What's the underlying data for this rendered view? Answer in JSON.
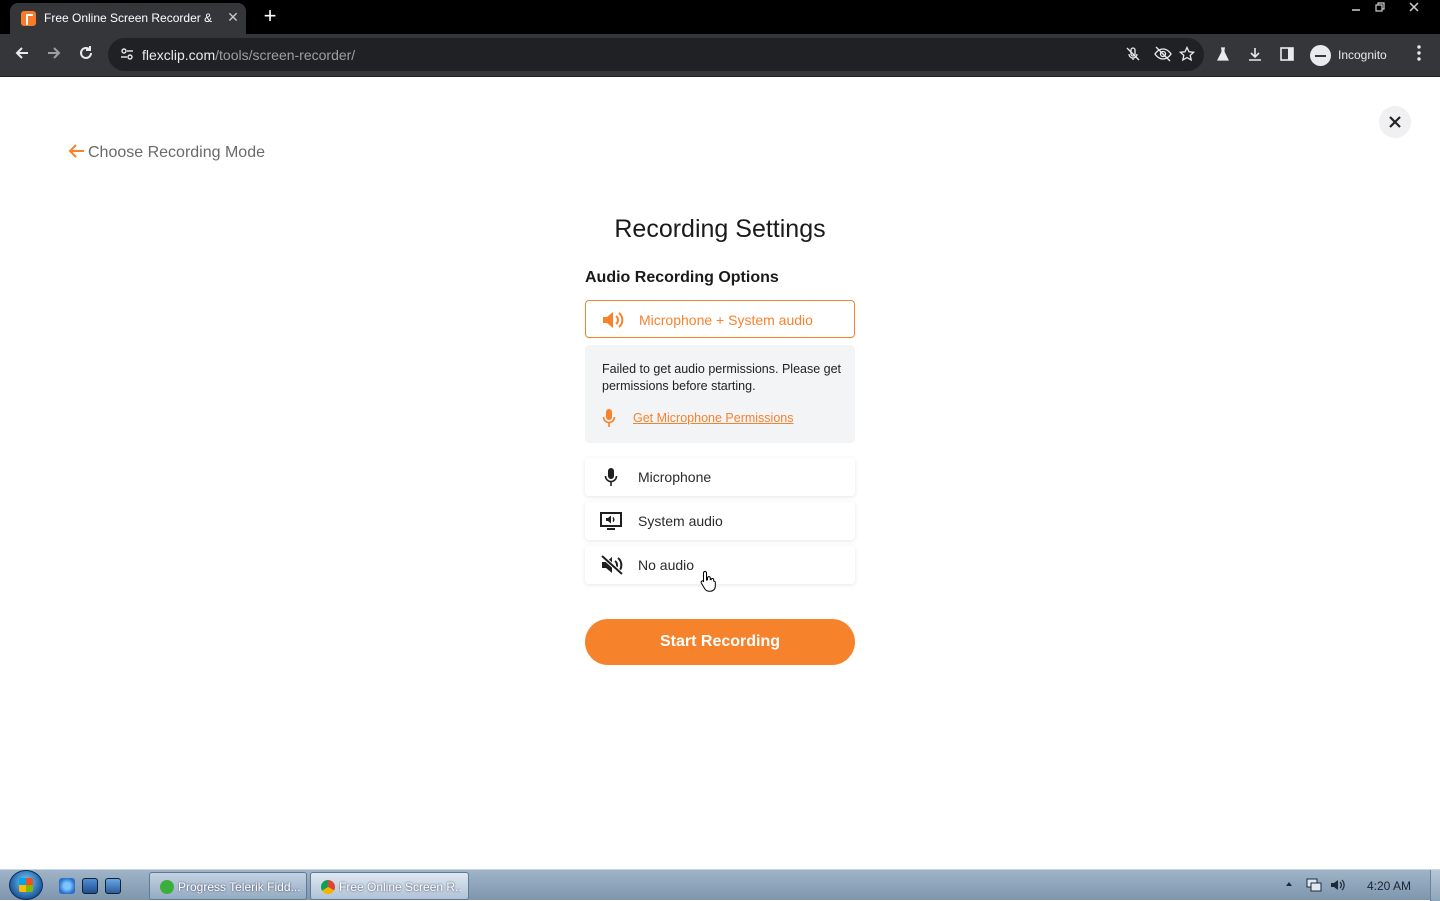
{
  "browser": {
    "tab_title": "Free Online Screen Recorder & Video",
    "tab_close": "✕",
    "new_tab": "+",
    "url_domain": "flexclip.com",
    "url_path": "/tools/screen-recorder/",
    "profile_label": "Incognito"
  },
  "page": {
    "back_label": "Choose Recording Mode",
    "title": "Recording Settings",
    "section_label": "Audio Recording Options",
    "options": [
      {
        "label": "Microphone + System audio",
        "icon": "speaker-icon",
        "selected": true
      },
      {
        "label": "Microphone",
        "icon": "microphone-icon",
        "selected": false
      },
      {
        "label": "System audio",
        "icon": "monitor-audio-icon",
        "selected": false
      },
      {
        "label": "No audio",
        "icon": "mute-icon",
        "selected": false
      }
    ],
    "permission_message": "Failed to get audio permissions. Please get permissions before starting.",
    "permission_link": "Get Microphone Permissions",
    "start_button": "Start Recording"
  },
  "taskbar": {
    "tasks": [
      {
        "label": "Progress Telerik Fidd..."
      },
      {
        "label": "Free Online Screen R..."
      }
    ],
    "clock": "4:20 AM"
  },
  "colors": {
    "accent": "#f7822c",
    "chrome_dark": "#35363a",
    "permission_bg": "#f3f4f6"
  }
}
